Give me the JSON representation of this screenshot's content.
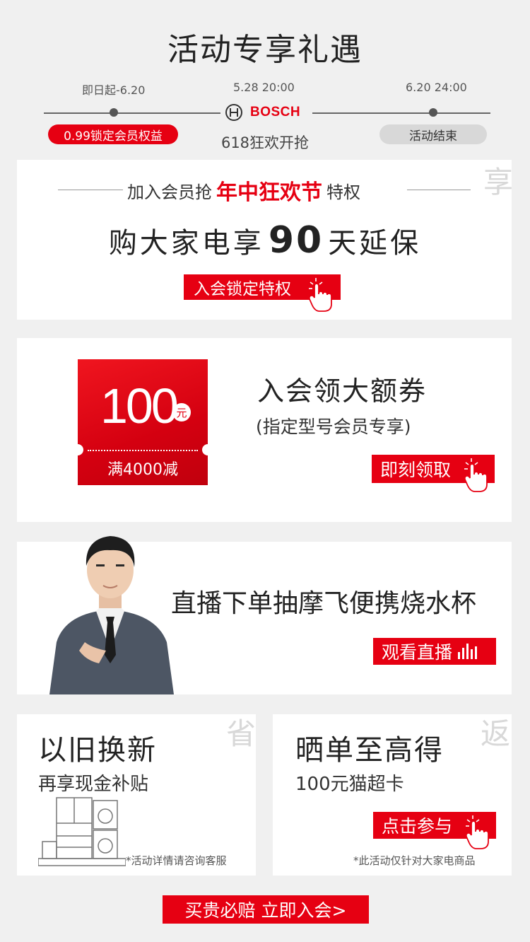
{
  "header": {
    "title": "活动专享礼遇",
    "timeline": {
      "left_date": "即日起-6.20",
      "center_date": "5.28 20:00",
      "right_date": "6.20 24:00",
      "brand": "BOSCH",
      "left_pill": "0.99锁定会员权益",
      "center_caption": "618狂欢开抢",
      "right_pill": "活动结束"
    }
  },
  "card_member": {
    "line1_prefix": "加入会员抢",
    "line1_highlight": "年中狂欢节",
    "line1_suffix": "特权",
    "line2_prefix": "购大家电享",
    "line2_number": "90",
    "line2_suffix": "天延保",
    "button": "入会锁定特权",
    "watermark": "享"
  },
  "card_coupon": {
    "coupon_value": "100",
    "coupon_unit": "元",
    "coupon_condition": "满4000减",
    "title": "入会领大额券",
    "subtitle": "(指定型号会员专享)",
    "button": "即刻领取"
  },
  "card_live": {
    "title": "直播下单抽摩飞便携烧水杯",
    "button": "观看直播"
  },
  "card_tradein": {
    "title": "以旧换新",
    "subtitle": "再享现金补贴",
    "note": "*活动详情请咨询客服",
    "watermark": "省"
  },
  "card_review": {
    "title": "晒单至高得",
    "subtitle": "100元猫超卡",
    "button": "点击参与",
    "note": "*此活动仅针对大家电商品",
    "watermark": "返"
  },
  "footer": {
    "button": "买贵必赔 立即入会>"
  },
  "colors": {
    "accent": "#e60012",
    "background": "#f0f0f0",
    "pill_gray": "#d8d8d8"
  },
  "icons": [
    "bosch-logo-icon",
    "hand-click-icon",
    "live-bars-icon",
    "appliance-outline-icon"
  ]
}
